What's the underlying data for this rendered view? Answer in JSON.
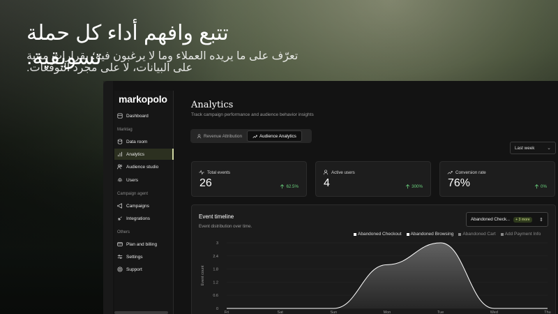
{
  "hero": {
    "title": "تتبع وافهم أداء كل حملة تسويقية.",
    "subtitle": "تعرّف على ما يريده العملاء وما لا يرغبون فيه؛ بقرارات مبنية على البيانات، لا على مجرد التوقعات."
  },
  "app": {
    "logo": "markopolo",
    "sidebar": {
      "items": [
        {
          "label": "Dashboard",
          "icon": "dashboard-icon"
        },
        {
          "label": "Data room",
          "icon": "database-icon"
        },
        {
          "label": "Analytics",
          "icon": "bar-chart-icon",
          "active": true
        },
        {
          "label": "Audience studio",
          "icon": "users-icon"
        },
        {
          "label": "Users",
          "icon": "fingerprint-icon"
        },
        {
          "label": "Campaigns",
          "icon": "megaphone-icon"
        },
        {
          "label": "Integrations",
          "icon": "plug-icon"
        },
        {
          "label": "Plan and billing",
          "icon": "credit-card-icon"
        },
        {
          "label": "Settings",
          "icon": "sliders-icon"
        },
        {
          "label": "Support",
          "icon": "lifebuoy-icon"
        }
      ],
      "groups": [
        "Marktag",
        "Campaign agent",
        "Others"
      ]
    },
    "main": {
      "title": "Analytics",
      "subtitle": "Track campaign performance and audience behavior insights",
      "tabs": [
        {
          "label": "Revenue Attribution",
          "icon": "person-icon"
        },
        {
          "label": "Audience Analytics",
          "icon": "trend-icon",
          "active": true
        }
      ],
      "period": "Last week",
      "cards": [
        {
          "label": "Total events",
          "value": "26",
          "delta": "62.5%",
          "icon": "activity-icon"
        },
        {
          "label": "Active users",
          "value": "4",
          "delta": "300%",
          "icon": "user-icon"
        },
        {
          "label": "Conversion rate",
          "value": "76%",
          "delta": "0%",
          "icon": "trend-up-icon"
        }
      ],
      "timeline": {
        "title": "Event timeline",
        "subtitle": "Event distribution over time.",
        "select_value": "Abandoned Check...",
        "select_more": "+ 3 more"
      }
    }
  },
  "colors": {
    "accent": "#cfd6a2",
    "positive": "#6ad07c",
    "series_active": "#ffffff",
    "series_inactive": "#8a8a8a"
  },
  "chart_data": {
    "type": "area",
    "ylabel": "Event count",
    "yticks": [
      0,
      0.6,
      1.2,
      1.8,
      2.4,
      3
    ],
    "x": [
      "Fri",
      "Sat",
      "Sun",
      "Mon",
      "Tue",
      "Wed",
      "Thu"
    ],
    "series": [
      {
        "name": "Abandoned Checkout",
        "values": [
          0,
          0,
          0,
          2,
          3,
          0,
          0
        ],
        "active": true
      },
      {
        "name": "Abandoned Browsing",
        "values": [],
        "active": true
      },
      {
        "name": "Abandoned Cart",
        "values": [],
        "active": false
      },
      {
        "name": "Add Payment Info",
        "values": [],
        "active": false
      }
    ],
    "ylim": [
      0,
      3
    ]
  }
}
